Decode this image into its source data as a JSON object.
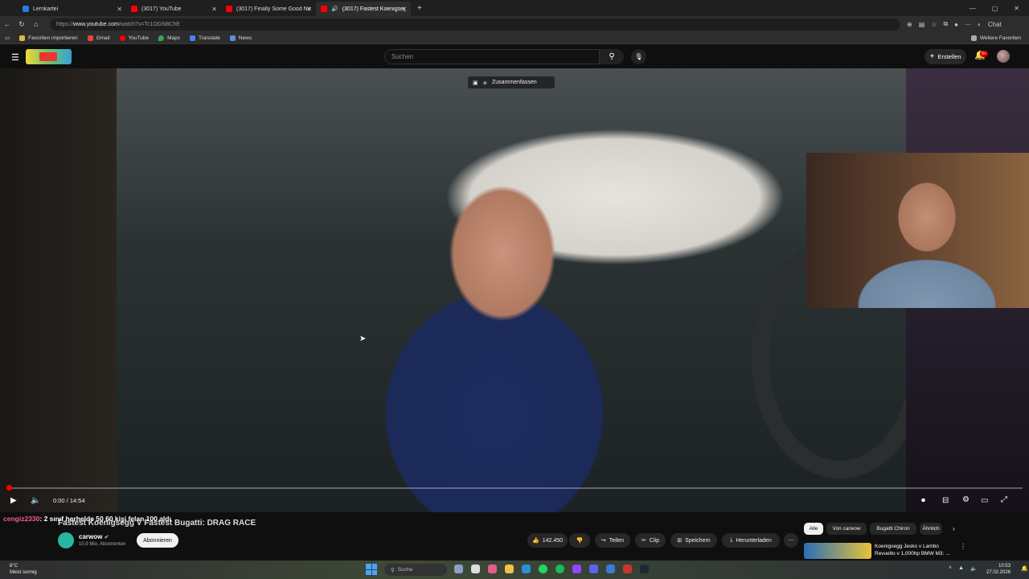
{
  "browser": {
    "tabs": [
      {
        "label": "Lernkartei",
        "icon": "lernkartei-icon"
      },
      {
        "label": "(3017) YouTube",
        "icon": "youtube-icon"
      },
      {
        "label": "(3017) Finally Some Good News Ab",
        "icon": "youtube-icon"
      },
      {
        "label": "(3017) Fastest Koenigsegg v F",
        "icon": "youtube-icon"
      }
    ],
    "url_prefix": "https://",
    "url_host": "www.youtube.com",
    "url_path": "/watch?v=Tc1OGN8ChE",
    "chat_label": "Chat",
    "bookmarks": [
      "Favoriten importieren",
      "Gmail",
      "YouTube",
      "Maps",
      "Translate",
      "News"
    ],
    "more_favorites": "Weitere Favoriten"
  },
  "youtube": {
    "search_placeholder": "Suchen",
    "create_label": "Erstellen",
    "notif_badge": "9+"
  },
  "player": {
    "summarize_label": "Zusammenfassen",
    "time": "0:00 / 14:54",
    "progress_fraction": 0.002
  },
  "chat_overlay": {
    "user": "cengiz2330",
    "message": ": 2 sınıf herhelde 50 60 kişi felan 100 aldı"
  },
  "video": {
    "title": "Fastest Koenigsegg V Fastest Bugatti: DRAG RACE",
    "channel": "carwow",
    "subscribers": "10,9 Mio. Abonnenten",
    "subscribe_label": "Abonnieren",
    "likes": "142.450",
    "share_label": "Teilen",
    "clip_label": "Clip",
    "save_label": "Speichern",
    "download_label": "Herunterladen"
  },
  "chips": [
    "Alle",
    "Von carwow",
    "Bugatti Chiron",
    "Ähnlich"
  ],
  "recommendation": {
    "title_line1": "Koenigsegg Jesko v Lambo",
    "title_line2": "Revuelto v 1,000hp BMW M3: ..."
  },
  "taskbar": {
    "temp": "8°C",
    "weather": "Meist sonnig",
    "search_label": "Suche",
    "time": "10:53",
    "date": "27.02.2026"
  }
}
